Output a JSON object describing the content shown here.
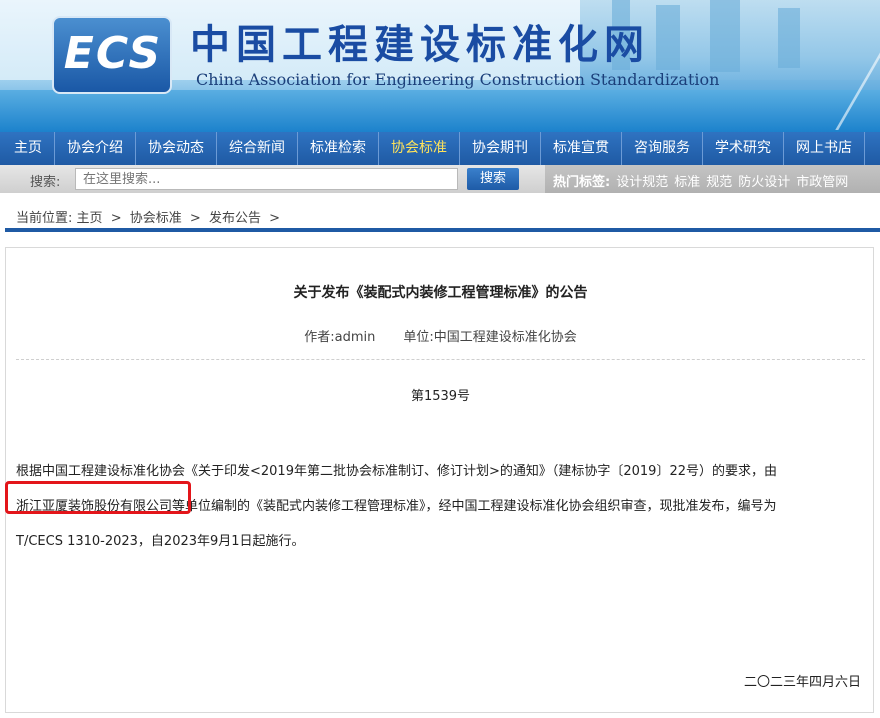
{
  "header": {
    "logo_text": "ECS",
    "title": "中国工程建设标准化网",
    "subtitle": "China Association for Engineering Construction Standardization"
  },
  "nav": {
    "items": [
      {
        "label": "主页",
        "active": false
      },
      {
        "label": "协会介绍",
        "active": false
      },
      {
        "label": "协会动态",
        "active": false
      },
      {
        "label": "综合新闻",
        "active": false
      },
      {
        "label": "标准检索",
        "active": false
      },
      {
        "label": "协会标准",
        "active": true
      },
      {
        "label": "协会期刊",
        "active": false
      },
      {
        "label": "标准宣贯",
        "active": false
      },
      {
        "label": "咨询服务",
        "active": false
      },
      {
        "label": "学术研究",
        "active": false
      },
      {
        "label": "网上书店",
        "active": false
      }
    ]
  },
  "search": {
    "label": "搜索:",
    "placeholder": "在这里搜索...",
    "button_label": "搜索",
    "hot_label": "热门标签:",
    "hot_tags": [
      "设计规范",
      "标准",
      "规范",
      "防火设计",
      "市政管网"
    ]
  },
  "breadcrumb": {
    "prefix": "当前位置:",
    "items": [
      "主页",
      "协会标准",
      "发布公告"
    ],
    "separator": ">"
  },
  "article": {
    "title": "关于发布《装配式内装修工程管理标准》的公告",
    "author": "作者:admin",
    "unit": "单位:中国工程建设标准化协会",
    "doc_number": "第1539号",
    "body_lines": [
      "根据中国工程建设标准化协会《关于印发<2019年第二批协会标准制订、修订计划>的通知》（建标协字〔2019〕22号）的要求，由",
      "浙江亚厦装饰股份有限公司等单位编制的《装配式内装修工程管理标准》，经中国工程建设标准化协会组织审查，现批准发布，编号为",
      "T/CECS 1310-2023，自2023年9月1日起施行。"
    ],
    "date": "二〇二三年四月六日"
  },
  "colors": {
    "nav_bg": "#1f5aa4",
    "nav_active": "#ffe35a",
    "highlight_border": "#e3151a"
  }
}
